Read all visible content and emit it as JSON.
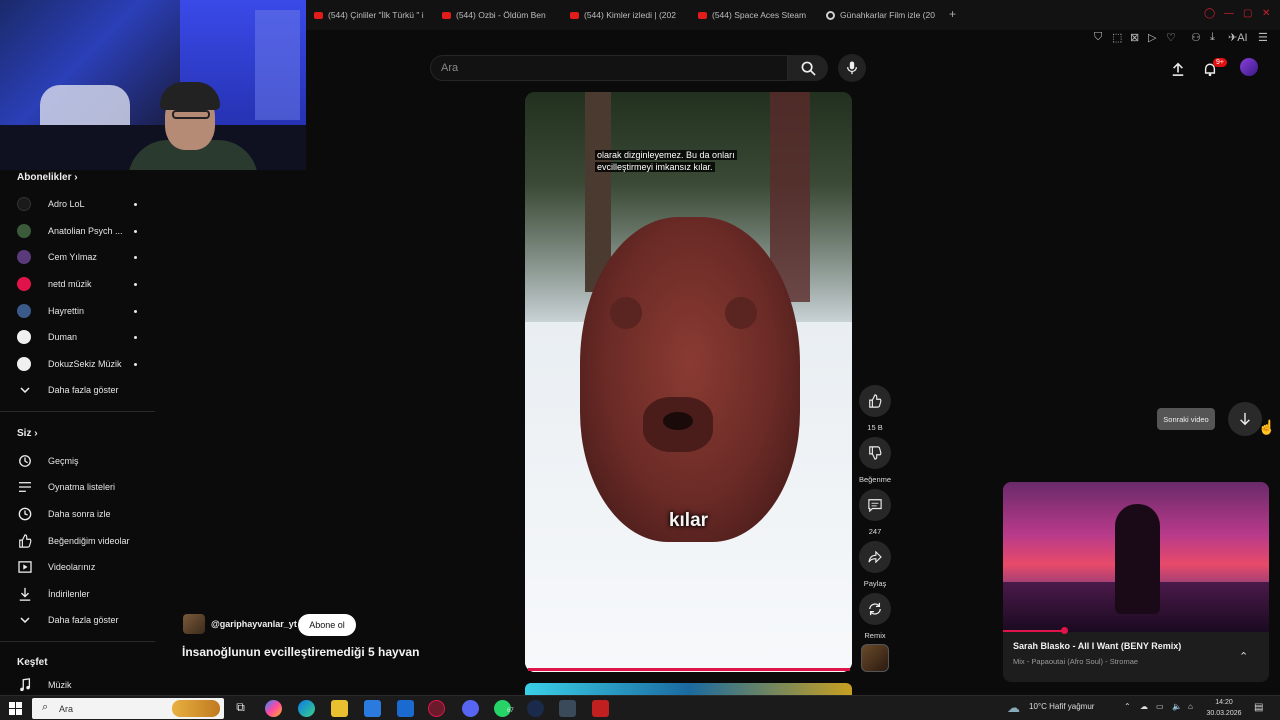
{
  "browser": {
    "tabs": [
      {
        "label": "(544) Çinliler \"İlk Türkü \" i",
        "icon": "youtube-icon"
      },
      {
        "label": "(544) Ozbi - Öldüm Ben",
        "icon": "youtube-icon"
      },
      {
        "label": "(544) Kimler izledi | (202",
        "icon": "youtube-icon"
      },
      {
        "label": "(544) Space Aces Steam",
        "icon": "youtube-icon"
      },
      {
        "label": "Günahkarlar Film izle (20",
        "icon": "globe-icon"
      }
    ],
    "new_tab": "+",
    "ai_label": "AI"
  },
  "header": {
    "search_placeholder": "Ara",
    "notification_count": "9+"
  },
  "sidebar": {
    "subscriptions_title": "Abonelikler",
    "subscriptions": [
      {
        "name": "Adro LoL",
        "color": "#1a1a1a"
      },
      {
        "name": "Anatolian Psych ...",
        "color": "#3a5a3a"
      },
      {
        "name": "Cem Yılmaz",
        "color": "#5a3a7a"
      },
      {
        "name": "netd müzik",
        "color": "#e0144a"
      },
      {
        "name": "Hayrettin",
        "color": "#3a5a8a"
      },
      {
        "name": "Duman",
        "color": "#f0f0f0"
      },
      {
        "name": "DokuzSekiz Müzik",
        "color": "#f0f0f0"
      }
    ],
    "show_more": "Daha fazla göster",
    "you_title": "Siz",
    "you_items": [
      {
        "label": "Geçmiş",
        "icon": "history-icon"
      },
      {
        "label": "Oynatma listeleri",
        "icon": "playlist-icon"
      },
      {
        "label": "Daha sonra izle",
        "icon": "clock-icon"
      },
      {
        "label": "Beğendiğim videolar",
        "icon": "thumbs-up-icon"
      },
      {
        "label": "Videolarınız",
        "icon": "video-icon"
      },
      {
        "label": "İndirilenler",
        "icon": "download-icon"
      }
    ],
    "you_show_more": "Daha fazla göster",
    "explore_title": "Keşfet",
    "explore_items": [
      {
        "label": "Müzik",
        "icon": "music-icon"
      }
    ]
  },
  "short": {
    "caption_top_1": "olarak dizginleyemez. Bu da onları",
    "caption_top_2": "evcilleştirmeyi imkansız kılar.",
    "caption_big": "kılar",
    "channel": "@gariphayvanlar_yt",
    "subscribe": "Abone ol",
    "title": "İnsanoğlunun evcilleştiremediği 5 hayvan",
    "progress": 1.0
  },
  "actions": {
    "likes": "15 B",
    "dislike": "Beğenme",
    "comments": "247",
    "share": "Paylaş",
    "remix": "Remix"
  },
  "next_video": {
    "tooltip": "Sonraki video"
  },
  "miniplayer": {
    "title": "Sarah Blasko - All I Want (BENY Remix)",
    "subtitle": "Mix - Papaoutai (Afro Soul) - Stromae",
    "progress": 0.23
  },
  "taskbar": {
    "search": "Ara",
    "badge": "67",
    "weather": "10°C  Hafif yağmur",
    "time": "14:20",
    "date": "30.03.2026"
  }
}
